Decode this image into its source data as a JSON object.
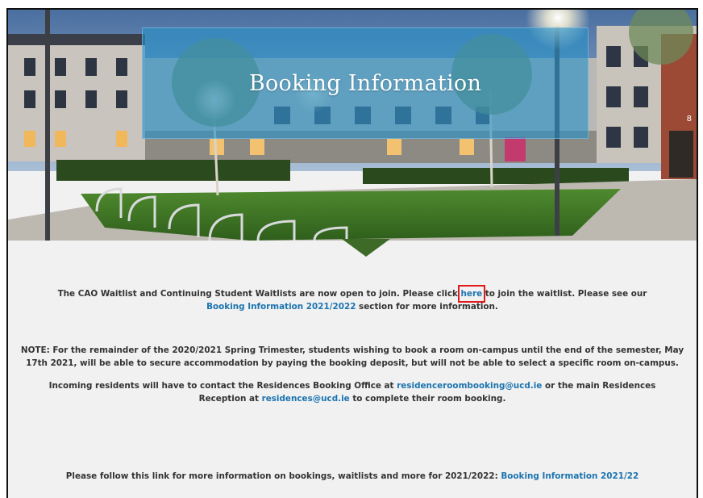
{
  "hero": {
    "title": "Booking Information",
    "building_number": "8"
  },
  "paragraph1": {
    "text_before": "The CAO Waitlist and Continuing Student Waitlists are now open to join. Please click ",
    "link_here": "here",
    "text_middle": " to join the waitlist. Please see our ",
    "link_booking": "Booking Information 2021/2022",
    "text_after": " section for more information."
  },
  "paragraph2": {
    "text": "NOTE: For the remainder of the 2020/2021 Spring Trimester, students wishing to book a room on-campus until the end of the semester, May 17th 2021, will be able to secure accommodation by paying the booking deposit, but will not be able to select a specific room on-campus."
  },
  "paragraph3": {
    "text_before": "Incoming residents will have to contact the Residences Booking Office at ",
    "link_email1": "residenceroombooking@ucd.ie",
    "text_middle": " or the main Residences Reception at ",
    "link_email2": "residences@ucd.ie",
    "text_after": " to complete their room booking."
  },
  "paragraph4": {
    "text_before": "Please follow this link for more information on bookings, waitlists and more for 2021/2022: ",
    "link": "Booking Information 2021/22"
  },
  "colors": {
    "link": "#1b74b0",
    "highlight_box": "#e0191a",
    "title_panel": "#2891c8",
    "text": "#333333"
  }
}
